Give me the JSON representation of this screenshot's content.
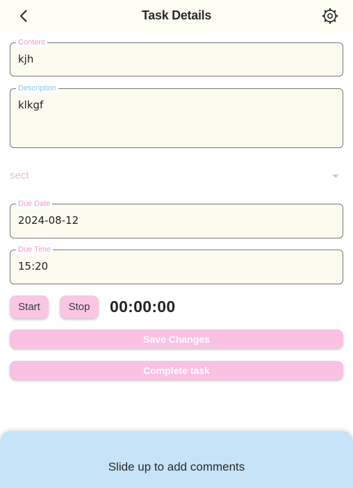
{
  "app_bar": {
    "title": "Task Details",
    "back_icon": "chevron-left-icon",
    "settings_icon": "gear-icon"
  },
  "fields": {
    "content": {
      "label": "Content",
      "value": "kjh"
    },
    "description": {
      "label": "Description",
      "value": "klkgf"
    },
    "due_date": {
      "label": "Due Date",
      "value": "2024-08-12"
    },
    "due_time": {
      "label": "Due Time",
      "value": "15:20"
    }
  },
  "section_dropdown": {
    "selected": "sect"
  },
  "timer": {
    "start_label": "Start",
    "stop_label": "Stop",
    "display": "00:00:00"
  },
  "actions": {
    "save_label": "Save Changes",
    "complete_label": "Complete task"
  },
  "bottom_sheet": {
    "text": "Slide up to add comments"
  },
  "colors": {
    "accent_pink": "#fbc1e3",
    "label_pink": "#ec9ad0",
    "label_blue": "#8cc8ea",
    "sheet_blue": "#c6e3f7",
    "field_bg": "#fbfbf0"
  }
}
